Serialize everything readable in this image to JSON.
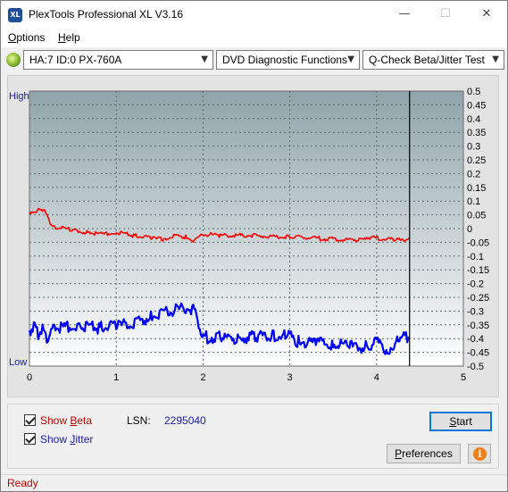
{
  "window": {
    "title": "PlexTools Professional XL V3.16",
    "app_icon_text": "XL",
    "minimize_glyph": "—",
    "maximize_glyph": "☐",
    "close_glyph": "✕"
  },
  "menu": {
    "options": "Options",
    "help": "Help"
  },
  "toolbar": {
    "drive_label": "HA:7 ID:0  PX-760A",
    "function_label": "DVD Diagnostic Functions",
    "test_label": "Q-Check Beta/Jitter Test",
    "dropdown_arrow": "▼"
  },
  "chart_data": {
    "type": "line",
    "title": "",
    "left_axis_labels": {
      "high": "High",
      "low": "Low"
    },
    "x_ticks": [
      0,
      1,
      2,
      3,
      4,
      5
    ],
    "xlim": [
      0,
      5
    ],
    "right_axis": {
      "ylim": [
        -0.5,
        0.5
      ],
      "ticks": [
        "0.5",
        "0.45",
        "0.4",
        "0.35",
        "0.3",
        "0.25",
        "0.2",
        "0.15",
        "0.1",
        "0.05",
        "0",
        "-0.05",
        "-0.1",
        "-0.15",
        "-0.2",
        "-0.25",
        "-0.3",
        "-0.35",
        "-0.4",
        "-0.45",
        "-0.5"
      ]
    },
    "grid": true,
    "end_marker_x": 4.38,
    "series": [
      {
        "color": "#ff0000",
        "x": [
          0.0,
          0.1,
          0.2,
          0.25,
          0.3,
          0.5,
          0.7,
          0.85,
          1.0,
          1.2,
          1.4,
          1.55,
          1.65,
          1.8,
          1.9,
          2.0,
          2.2,
          2.5,
          2.8,
          3.0,
          3.3,
          3.6,
          3.8,
          3.9,
          4.0,
          4.2,
          4.3,
          4.38
        ],
        "y": [
          0.06,
          0.065,
          0.06,
          0.01,
          0.005,
          -0.005,
          -0.015,
          -0.02,
          -0.015,
          -0.025,
          -0.035,
          -0.04,
          -0.025,
          -0.03,
          -0.045,
          -0.02,
          -0.025,
          -0.025,
          -0.03,
          -0.03,
          -0.035,
          -0.04,
          -0.04,
          -0.03,
          -0.035,
          -0.04,
          -0.045,
          -0.035
        ]
      },
      {
        "color": "#0000ff",
        "x": [
          0.0,
          0.05,
          0.1,
          0.15,
          0.2,
          0.25,
          0.3,
          0.4,
          0.6,
          0.8,
          1.0,
          1.1,
          1.2,
          1.4,
          1.5,
          1.6,
          1.7,
          1.8,
          1.9,
          1.95,
          2.0,
          2.2,
          2.4,
          2.6,
          2.8,
          2.95,
          3.1,
          3.3,
          3.5,
          3.7,
          3.9,
          4.0,
          4.1,
          4.2,
          4.25,
          4.3,
          4.38
        ],
        "y": [
          -0.37,
          -0.36,
          -0.38,
          -0.36,
          -0.4,
          -0.37,
          -0.36,
          -0.355,
          -0.36,
          -0.36,
          -0.355,
          -0.35,
          -0.34,
          -0.32,
          -0.31,
          -0.3,
          -0.295,
          -0.29,
          -0.3,
          -0.35,
          -0.395,
          -0.395,
          -0.4,
          -0.39,
          -0.39,
          -0.385,
          -0.41,
          -0.415,
          -0.42,
          -0.43,
          -0.43,
          -0.415,
          -0.44,
          -0.445,
          -0.39,
          -0.39,
          -0.395
        ]
      }
    ]
  },
  "bottom": {
    "show_beta_prefix": "Show ",
    "show_beta_accel": "B",
    "show_beta_suffix": "eta",
    "show_jitter_prefix": "Show ",
    "show_jitter_accel": "J",
    "show_jitter_suffix": "itter",
    "beta_color": "#c00000",
    "jitter_color": "#1a1aa6",
    "lsn_label": "LSN:",
    "lsn_value": "2295040",
    "start_accel": "S",
    "start_suffix": "tart",
    "preferences_accel": "P",
    "preferences_suffix": "references",
    "info_glyph": "i"
  },
  "status": {
    "text": "Ready"
  }
}
